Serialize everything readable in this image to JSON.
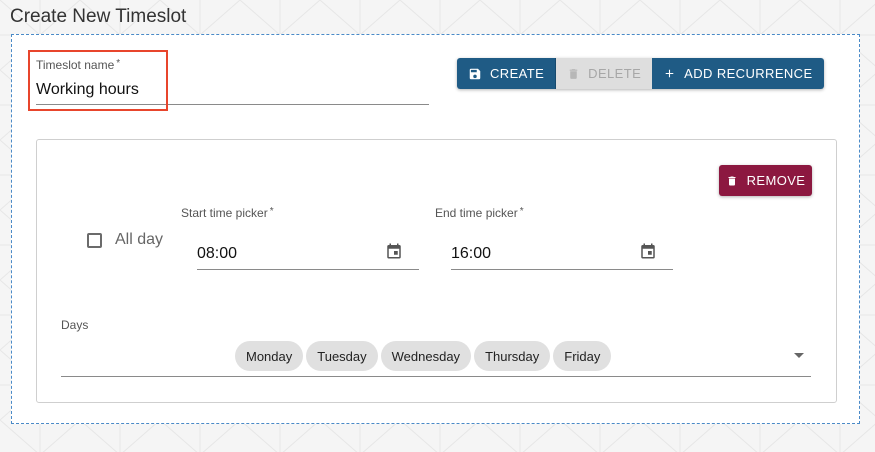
{
  "page": {
    "title": "Create New Timeslot"
  },
  "form": {
    "timeslot_name": {
      "label": "Timeslot name",
      "required_mark": "*",
      "value": "Working hours"
    },
    "buttons": {
      "create": "CREATE",
      "delete": "DELETE",
      "add_recurrence": "ADD RECURRENCE"
    }
  },
  "recurrence": {
    "remove_label": "REMOVE",
    "all_day_label": "All day",
    "all_day_checked": false,
    "start_time": {
      "label": "Start time picker",
      "required_mark": "*",
      "value": "08:00"
    },
    "end_time": {
      "label": "End time picker",
      "required_mark": "*",
      "value": "16:00"
    },
    "days_label": "Days",
    "days": [
      "Monday",
      "Tuesday",
      "Wednesday",
      "Thursday",
      "Friday"
    ]
  },
  "icons": {
    "create": "save-icon",
    "delete": "trash-icon",
    "add_recurrence": "plus-icon",
    "remove": "trash-icon",
    "time_picker": "calendar-icon",
    "days_dropdown": "chevron-down-icon"
  },
  "colors": {
    "primary": "#1f5b85",
    "danger": "#8c1840",
    "disabled_bg": "#dedede",
    "highlight": "#e8452c",
    "panel_border": "#4a8ac7"
  }
}
